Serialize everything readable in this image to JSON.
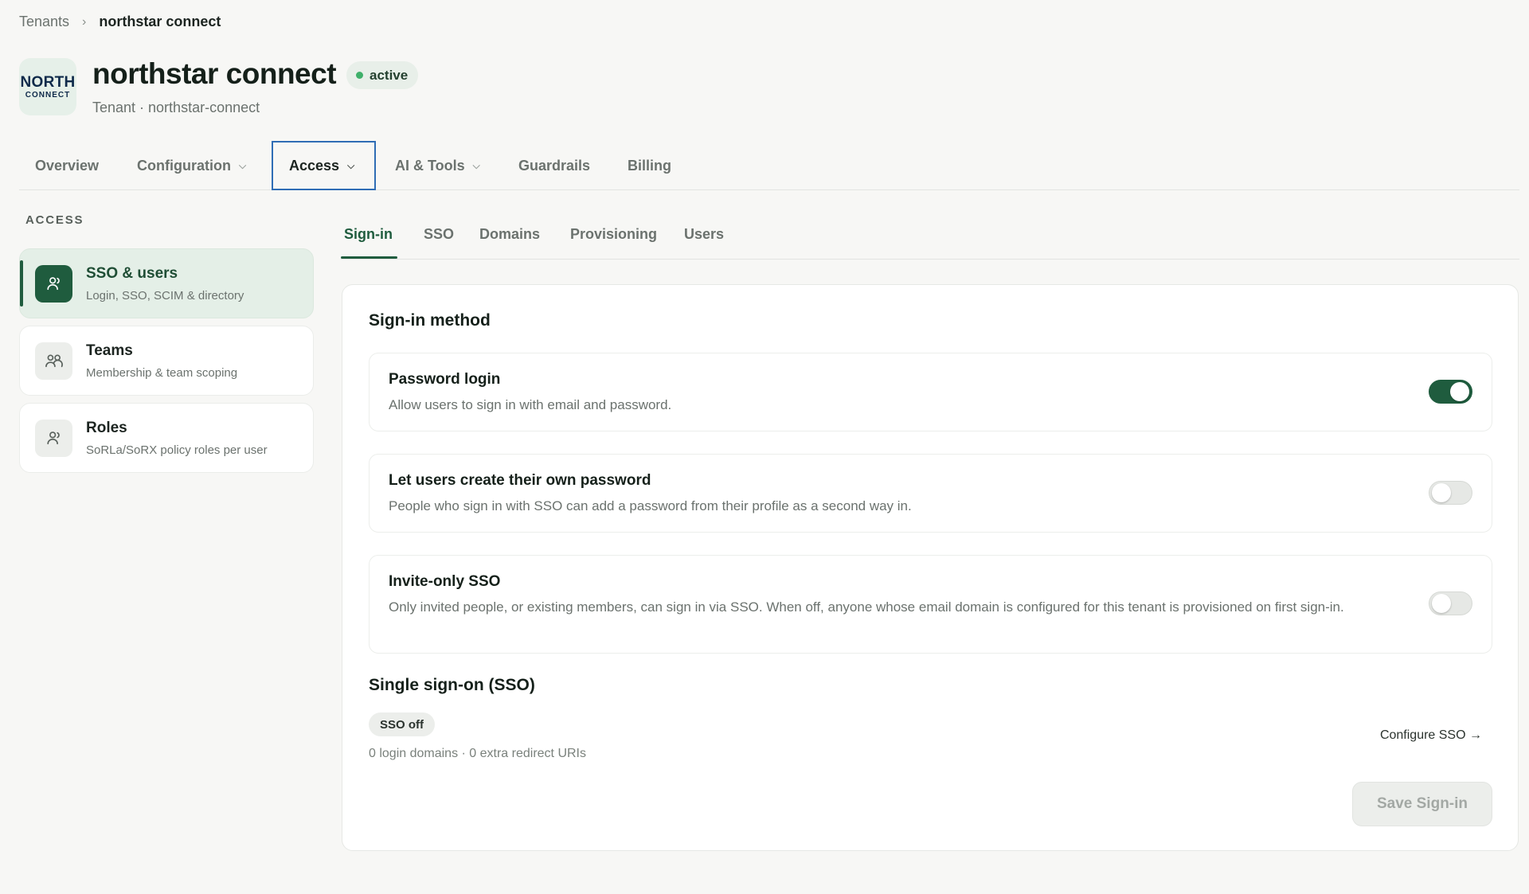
{
  "breadcrumb": {
    "parent": "Tenants",
    "separator": "›",
    "current": "northstar connect"
  },
  "tenant": {
    "logo_line1": "NORTH",
    "logo_line2": "CONNECT",
    "name": "northstar connect",
    "status": "active",
    "subtitle": "Tenant · northstar-connect"
  },
  "tabs": [
    {
      "label": "Overview",
      "has_menu": false
    },
    {
      "label": "Configuration",
      "has_menu": true
    },
    {
      "label": "Access",
      "has_menu": true,
      "active": true
    },
    {
      "label": "AI & Tools",
      "has_menu": true
    },
    {
      "label": "Guardrails",
      "has_menu": false
    },
    {
      "label": "Billing",
      "has_menu": false
    }
  ],
  "sidebar": {
    "heading": "ACCESS",
    "items": [
      {
        "title": "SSO & users",
        "desc": "Login, SSO, SCIM & directory",
        "icon": "user-icon",
        "active": true
      },
      {
        "title": "Teams",
        "desc": "Membership & team scoping",
        "icon": "users-icon"
      },
      {
        "title": "Roles",
        "desc": "SoRLa/SoRX policy roles per user",
        "icon": "user-icon"
      }
    ]
  },
  "subtabs": [
    {
      "label": "Sign-in",
      "active": true
    },
    {
      "label": "SSO"
    },
    {
      "label": "Domains"
    },
    {
      "label": "Provisioning"
    },
    {
      "label": "Users"
    }
  ],
  "signin": {
    "section_title": "Sign-in method",
    "settings": [
      {
        "title": "Password login",
        "desc": "Allow users to sign in with email and password.",
        "enabled": true
      },
      {
        "title": "Let users create their own password",
        "desc": "People who sign in with SSO can add a password from their profile as a second way in.",
        "enabled": false
      },
      {
        "title": "Invite-only SSO",
        "desc": "Only invited people, or existing members, can sign in via SSO. When off, anyone whose email domain is configured for this tenant is provisioned on first sign-in.",
        "enabled": false
      }
    ],
    "sso_title": "Single sign-on (SSO)",
    "sso_badge": "SSO off",
    "sso_meta": "0 login domains · 0 extra redirect URIs",
    "configure_link": "Configure SSO →",
    "save_label": "Save Sign-in"
  },
  "colors": {
    "accent": "#1f5c3e",
    "active_tab_border": "#2f6db5",
    "status_dot": "#3fb06a"
  }
}
